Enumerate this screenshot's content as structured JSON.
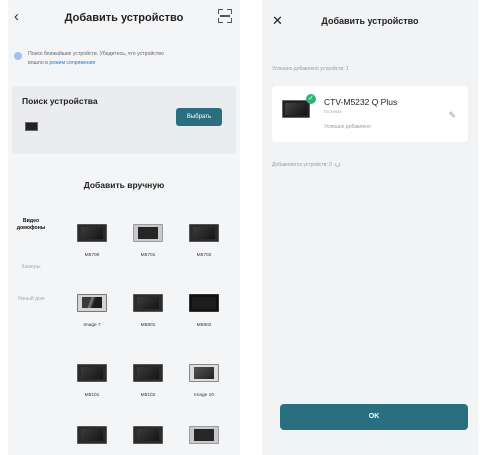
{
  "left": {
    "header": {
      "back_icon": "chevron-left-icon",
      "title": "Добавить устройство",
      "scan_icon": "scan-icon"
    },
    "info": {
      "line1": "Поиск ближайших устройств. Убедитесь, что устройство",
      "line2_prefix": "вошло в ",
      "link": "режим сопряжения"
    },
    "search": {
      "title": "Поиск устройства",
      "select_label": "Выбрать"
    },
    "manual_title": "Добавить вручную",
    "categories": [
      {
        "label": "Видео домофоны"
      },
      {
        "label": "Камеры"
      },
      {
        "label": "Умный дом"
      }
    ],
    "devices": [
      {
        "label": "M5700"
      },
      {
        "label": "M5701"
      },
      {
        "label": "M5702"
      },
      {
        "label": "Image 7"
      },
      {
        "label": "M5801"
      },
      {
        "label": "M5902"
      },
      {
        "label": "M5101"
      },
      {
        "label": "M5102"
      },
      {
        "label": "Image 10"
      },
      {
        "label": ""
      },
      {
        "label": ""
      },
      {
        "label": ""
      }
    ]
  },
  "right": {
    "header": {
      "close_icon": "close-icon",
      "title": "Добавить устройство"
    },
    "added_heading": "Успешно добавлено устройств: 1",
    "device": {
      "name": "CTV-M5232 Q Plus",
      "sub": "Гостиная",
      "status": "Успешно добавлено"
    },
    "adding_label": "Добавляется устройств: 0",
    "ok_label": "OK"
  },
  "colors": {
    "accent": "#2a6f80",
    "success": "#2bb673",
    "link": "#2f78c4"
  }
}
